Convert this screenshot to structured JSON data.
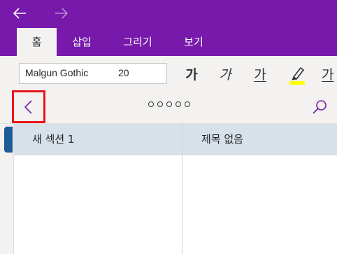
{
  "titlebar": {
    "back_icon": "arrow-left-icon",
    "forward_icon": "arrow-right-icon"
  },
  "tabs": [
    {
      "label": "홈",
      "active": true
    },
    {
      "label": "삽입",
      "active": false
    },
    {
      "label": "그리기",
      "active": false
    },
    {
      "label": "보기",
      "active": false
    }
  ],
  "ribbon": {
    "font_name": "Malgun Gothic",
    "font_size": "20",
    "bold_label": "가",
    "italic_label": "가",
    "underline_label": "가",
    "font_color_label": "가",
    "highlight_icon": "highlighter-icon",
    "highlight_color": "#ffff00"
  },
  "navigation": {
    "collapse_icon": "chevron-left-icon",
    "search_icon": "search-icon",
    "dot_count": 5
  },
  "sections": [
    {
      "label": "새 섹션 1",
      "selected": true
    }
  ],
  "pages": [
    {
      "label": "제목 없음",
      "selected": true
    }
  ],
  "colors": {
    "accent": "#7719aa",
    "selection": "#d7e1ea",
    "section_tab": "#1e5c97",
    "focus_outline": "#e8161b"
  }
}
